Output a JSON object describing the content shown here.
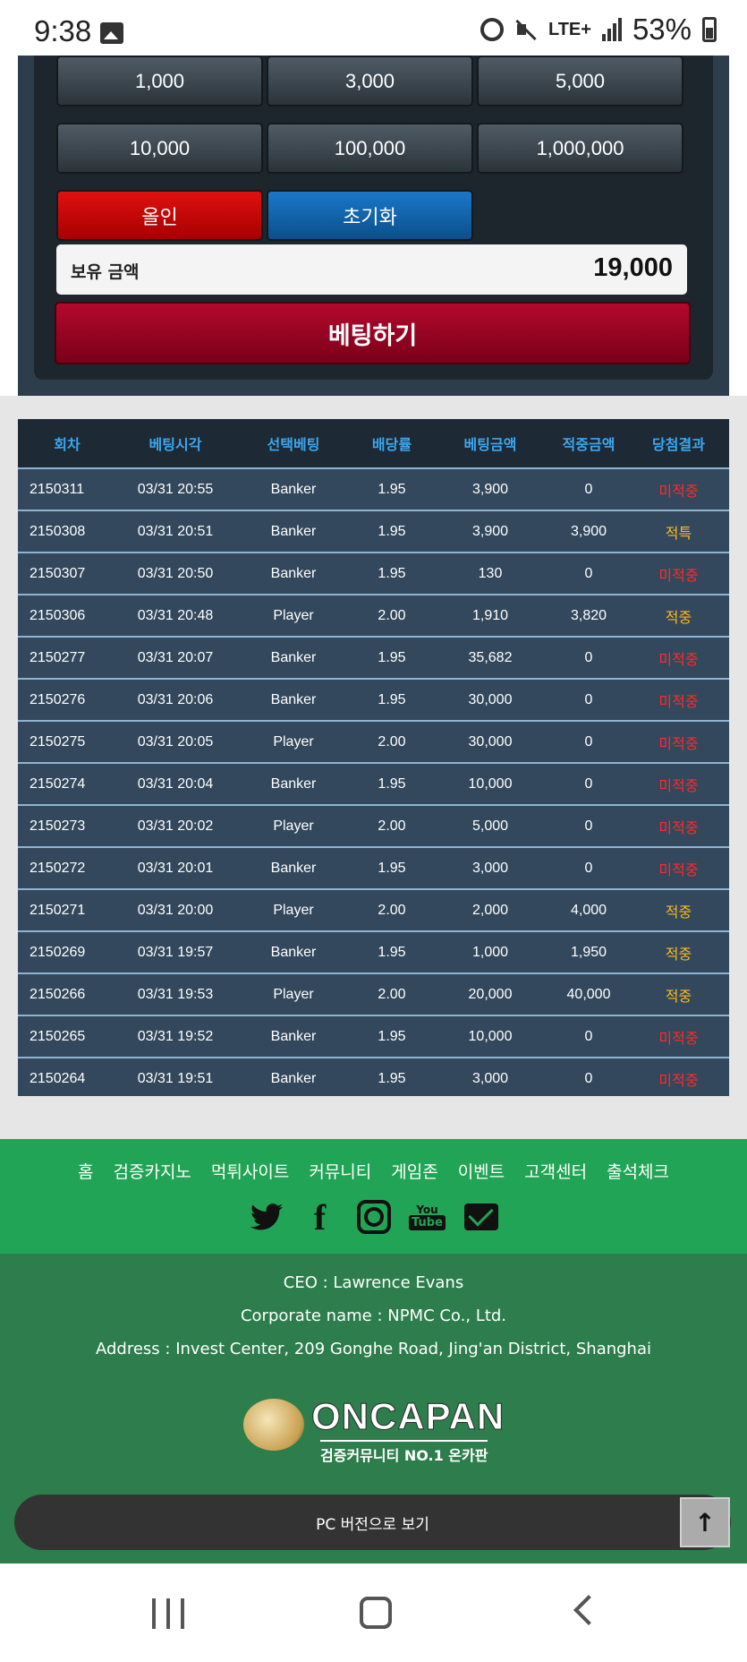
{
  "status_bar": {
    "time": "9:38",
    "network": "LTE+",
    "battery": "53%"
  },
  "bet_panel": {
    "chips_row1": [
      "1,000",
      "3,000",
      "5,000"
    ],
    "chips_row2": [
      "10,000",
      "100,000",
      "1,000,000"
    ],
    "allin_label": "올인",
    "reset_label": "초기화",
    "balance_label": "보유 금액",
    "balance_value": "19,000",
    "bet_button_label": "베팅하기"
  },
  "history": {
    "headers": [
      "회차",
      "베팅시각",
      "선택베팅",
      "배당률",
      "베팅금액",
      "적중금액",
      "당첨결과"
    ],
    "rows": [
      {
        "round": "2150311",
        "time": "03/31 20:55",
        "pick": "Banker",
        "odds": "1.95",
        "amount": "3,900",
        "payout": "0",
        "result": "미적중",
        "win": false
      },
      {
        "round": "2150308",
        "time": "03/31 20:51",
        "pick": "Banker",
        "odds": "1.95",
        "amount": "3,900",
        "payout": "3,900",
        "result": "적특",
        "win": true
      },
      {
        "round": "2150307",
        "time": "03/31 20:50",
        "pick": "Banker",
        "odds": "1.95",
        "amount": "130",
        "payout": "0",
        "result": "미적중",
        "win": false
      },
      {
        "round": "2150306",
        "time": "03/31 20:48",
        "pick": "Player",
        "odds": "2.00",
        "amount": "1,910",
        "payout": "3,820",
        "result": "적중",
        "win": true
      },
      {
        "round": "2150277",
        "time": "03/31 20:07",
        "pick": "Banker",
        "odds": "1.95",
        "amount": "35,682",
        "payout": "0",
        "result": "미적중",
        "win": false
      },
      {
        "round": "2150276",
        "time": "03/31 20:06",
        "pick": "Banker",
        "odds": "1.95",
        "amount": "30,000",
        "payout": "0",
        "result": "미적중",
        "win": false
      },
      {
        "round": "2150275",
        "time": "03/31 20:05",
        "pick": "Player",
        "odds": "2.00",
        "amount": "30,000",
        "payout": "0",
        "result": "미적중",
        "win": false
      },
      {
        "round": "2150274",
        "time": "03/31 20:04",
        "pick": "Banker",
        "odds": "1.95",
        "amount": "10,000",
        "payout": "0",
        "result": "미적중",
        "win": false
      },
      {
        "round": "2150273",
        "time": "03/31 20:02",
        "pick": "Player",
        "odds": "2.00",
        "amount": "5,000",
        "payout": "0",
        "result": "미적중",
        "win": false
      },
      {
        "round": "2150272",
        "time": "03/31 20:01",
        "pick": "Banker",
        "odds": "1.95",
        "amount": "3,000",
        "payout": "0",
        "result": "미적중",
        "win": false
      },
      {
        "round": "2150271",
        "time": "03/31 20:00",
        "pick": "Player",
        "odds": "2.00",
        "amount": "2,000",
        "payout": "4,000",
        "result": "적중",
        "win": true
      },
      {
        "round": "2150269",
        "time": "03/31 19:57",
        "pick": "Banker",
        "odds": "1.95",
        "amount": "1,000",
        "payout": "1,950",
        "result": "적중",
        "win": true
      },
      {
        "round": "2150266",
        "time": "03/31 19:53",
        "pick": "Player",
        "odds": "2.00",
        "amount": "20,000",
        "payout": "40,000",
        "result": "적중",
        "win": true
      },
      {
        "round": "2150265",
        "time": "03/31 19:52",
        "pick": "Banker",
        "odds": "1.95",
        "amount": "10,000",
        "payout": "0",
        "result": "미적중",
        "win": false
      },
      {
        "round": "2150264",
        "time": "03/31 19:51",
        "pick": "Banker",
        "odds": "1.95",
        "amount": "3,000",
        "payout": "0",
        "result": "미적중",
        "win": false
      }
    ]
  },
  "footer": {
    "nav": [
      "홈",
      "검증카지노",
      "먹튀사이트",
      "커뮤니티",
      "게임존",
      "이벤트",
      "고객센터",
      "출석체크"
    ],
    "social_icons": [
      "twitter-icon",
      "facebook-icon",
      "instagram-icon",
      "youtube-icon",
      "mail-icon"
    ],
    "youtube_text_top": "You",
    "youtube_text_bottom": "Tube",
    "ceo": "CEO : Lawrence Evans",
    "corporate": "Corporate name : NPMC Co., Ltd.",
    "address": "Address : Invest Center, 209 Gonghe Road, Jing'an District, Shanghai",
    "logo_text": "ONCAPAN",
    "logo_sub": "검증커뮤니티 NO.1 온카판",
    "pc_version_label": "PC 버전으로 보기",
    "top_button_glyph": "↑"
  },
  "colors": {
    "panel": "#2e3d4b",
    "table_bg": "#33485c",
    "header_text": "#3aa7f0",
    "lose": "#ff2a2a",
    "win": "#ffb81c",
    "footer_green": "#21a455",
    "footer_dark_green": "#2d7e4c",
    "bet_button": "#9a0020"
  }
}
